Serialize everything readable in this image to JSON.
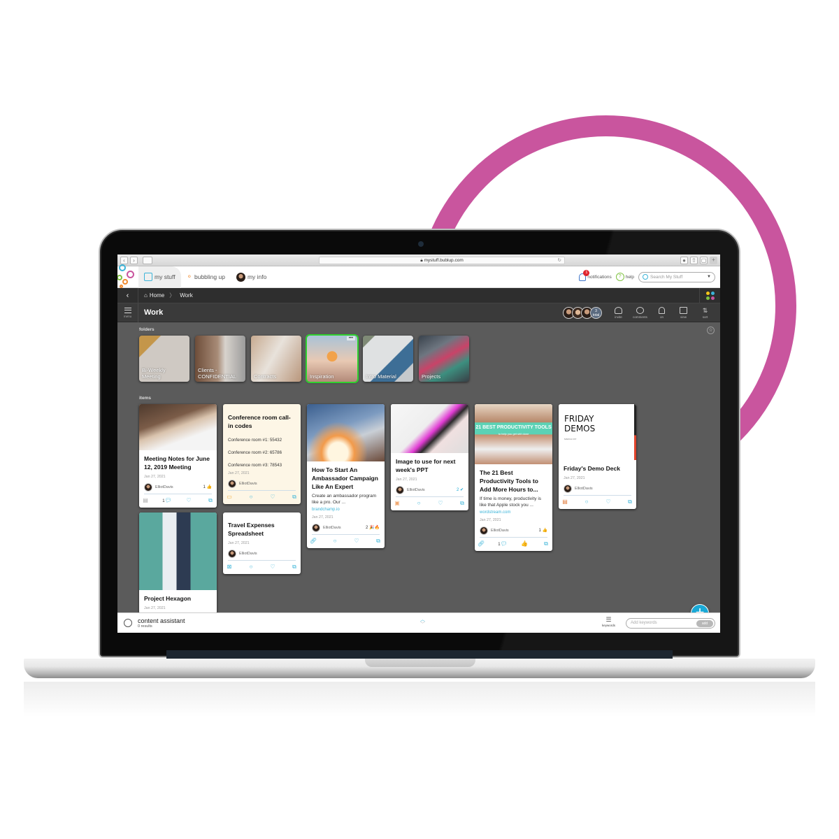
{
  "browser": {
    "url": "mystuff.bublup.com",
    "nav_back": "‹",
    "nav_forward": "›"
  },
  "app_header": {
    "tabs": [
      {
        "label": "my stuff",
        "icon": "cube-icon",
        "active": true
      },
      {
        "label": "bubbling up",
        "icon": "bubbles-icon",
        "active": false
      },
      {
        "label": "my info",
        "icon": "avatar-icon",
        "active": false
      }
    ],
    "notifications": {
      "label": "notifications",
      "count": "1"
    },
    "help": {
      "label": "help"
    },
    "search": {
      "placeholder": "Search My Stuff"
    }
  },
  "breadcrumb": {
    "back": "‹",
    "items": [
      "Home",
      "Work"
    ]
  },
  "titlebar": {
    "menu_label": "menu",
    "title": "Work",
    "members_total": "3",
    "members_total_label": "total",
    "tools": [
      {
        "label": "invite",
        "icon": "invite-icon"
      },
      {
        "label": "comments",
        "icon": "comments-icon"
      },
      {
        "label": "on",
        "icon": "bell-icon"
      },
      {
        "label": "view",
        "icon": "view-icon"
      },
      {
        "label": "sort",
        "icon": "sort-icon"
      }
    ]
  },
  "folders": {
    "heading": "folders",
    "items": [
      {
        "label": "Bi-Weekly Meeting",
        "selected": false
      },
      {
        "label": "Clients - CONFIDENTIAL",
        "selected": false
      },
      {
        "label": "Contracts",
        "selected": false
      },
      {
        "label": "Inspiration",
        "selected": true,
        "more": "•••"
      },
      {
        "label": "Intro Material",
        "selected": false
      },
      {
        "label": "Projects",
        "selected": false
      }
    ]
  },
  "items": {
    "heading": "items",
    "cards": [
      {
        "title": "Meeting Notes for June 12, 2019 Meeting",
        "date": "Jan 27, 2021",
        "owner": "ElliotDavis",
        "reaction": "1 👍",
        "comments": "1",
        "type_icon": "document-icon"
      },
      {
        "title": "Conference room call-in codes",
        "lines": [
          "Conference room #1: 55432",
          "Conference room #2: 65786",
          "Conference room #3: 78543"
        ],
        "date": "Jan 27, 2021",
        "owner": "ElliotDavis",
        "type_icon": "note-icon"
      },
      {
        "title": "How To Start An Ambassador Campaign Like An Expert",
        "description": "Create an ambassador program like a pro. Our ...",
        "link": "brandchamp.io",
        "date": "Jan 27, 2021",
        "owner": "ElliotDavis",
        "reaction": "2 🎉🔥",
        "type_icon": "link-icon"
      },
      {
        "title": "Image to use for next week's PPT",
        "date": "Jan 27, 2021",
        "owner": "ElliotDavis",
        "reaction": "2 ✔",
        "type_icon": "image-icon"
      },
      {
        "title": "The 21 Best Productivity Tools to Add More Hours to...",
        "description": "If time is money, productivity is like that Apple stock you ...",
        "link": "wordstream.com",
        "date": "Jan 27, 2021",
        "owner": "ElliotDavis",
        "reaction": "1 👍",
        "comments": "1",
        "type_icon": "link-icon",
        "image_banner": "21 BEST PRODUCTIVITY TOOLS",
        "image_sub": "to help you get shit done"
      },
      {
        "title": "Friday's Demo Deck",
        "date": "Jan 27, 2021",
        "owner": "ElliotDavis",
        "type_icon": "presentation-icon",
        "preview_title": "FRIDAY DEMOS",
        "preview_sub": "MARCH 1ST"
      },
      {
        "title": "Project Hexagon",
        "date": "Jan 27, 2021",
        "type_icon": "image-icon"
      },
      {
        "title": "Travel Expenses Spreadsheet",
        "date": "Jan 27, 2021",
        "owner": "ElliotDavis",
        "type_icon": "spreadsheet-icon"
      }
    ]
  },
  "assistant": {
    "title": "content assistant",
    "results": "0 results",
    "keywords_label": "keywords",
    "keywords_placeholder": "Add keywords",
    "add_label": "add"
  },
  "colors": {
    "ring": "#c9559e",
    "accent": "#1aa9d6",
    "selected_folder": "#2fd12f",
    "notification_badge": "#e0242c"
  }
}
